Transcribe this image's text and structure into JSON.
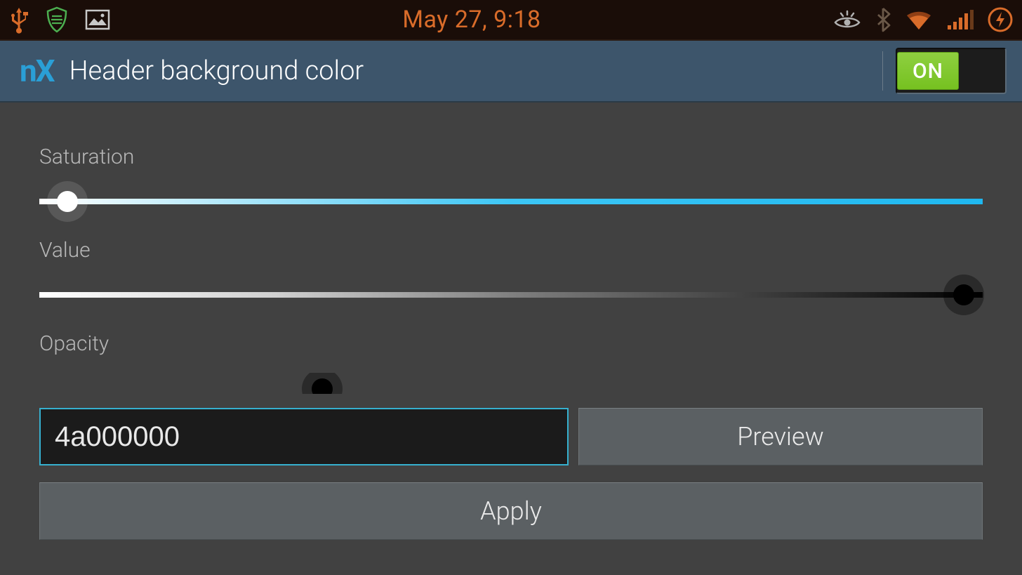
{
  "status_bar": {
    "time_text": "May 27, 9:18"
  },
  "header": {
    "logo_n": "n",
    "logo_x": "X",
    "title": "Header background color",
    "toggle_label": "ON",
    "toggle_state": true
  },
  "sliders": {
    "saturation": {
      "label": "Saturation",
      "position_pct": 3
    },
    "value": {
      "label": "Value",
      "position_pct": 98
    },
    "opacity": {
      "label": "Opacity",
      "position_pct": 30
    }
  },
  "hex_value": "4a000000",
  "buttons": {
    "preview": "Preview",
    "apply": "Apply"
  },
  "colors": {
    "accent": "#36b0cf",
    "toggle_on": "#76c120"
  }
}
